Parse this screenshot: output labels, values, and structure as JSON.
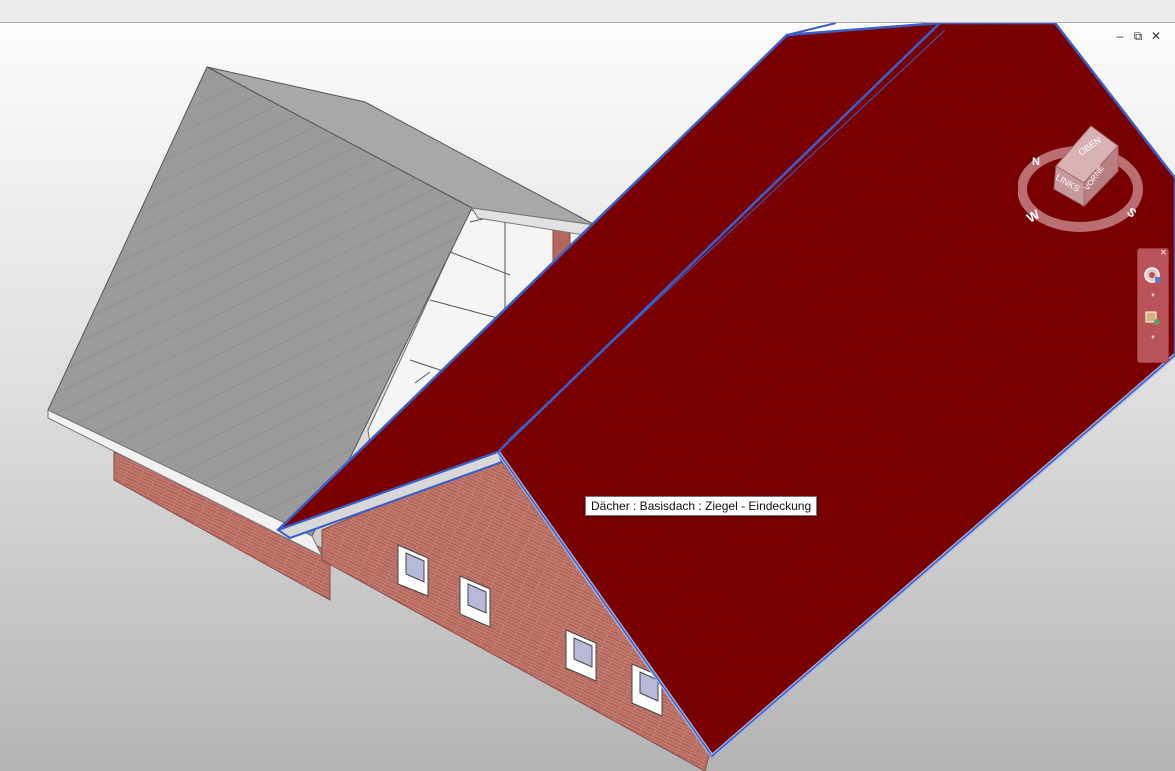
{
  "window": {
    "controls": {
      "minimize": "–",
      "restore": "⧉",
      "close": "✕"
    }
  },
  "tooltip": {
    "text": "Dächer : Basisdach : Ziegel - Eindeckung"
  },
  "viewcube": {
    "faces": {
      "top": "OBEN",
      "left": "LINKS",
      "front": "VORNE"
    },
    "compass": {
      "north": "N",
      "west": "W",
      "south": "S"
    }
  },
  "navigation_bar": {
    "buttons": [
      "steering-wheel",
      "zoom"
    ]
  },
  "colors": {
    "roof_tiles": "#7a0000",
    "selection_outline": "#3a5ec8",
    "brick": "#b5675c",
    "metal_roof": "#9b9b9b"
  }
}
